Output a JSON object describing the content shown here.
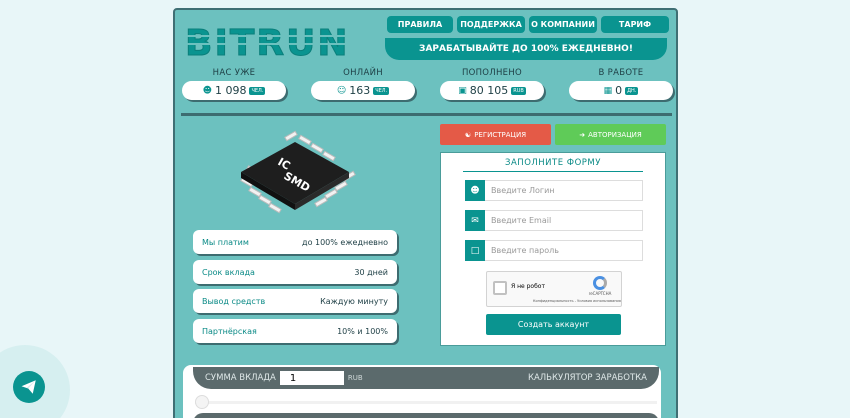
{
  "header": {
    "logo_text": "BITRUN",
    "nav": [
      "ПРАВИЛА",
      "ПОДДЕРЖКА",
      "О КОМПАНИИ",
      "ТАРИФ"
    ],
    "tagline": "ЗАРАБАТЫВАЙТЕ ДО 100% ЕЖЕДНЕВНО!"
  },
  "stats": [
    {
      "label": "НАС УЖЕ",
      "value": "1 098",
      "unit": "ЧЕЛ.",
      "icon": "users-icon"
    },
    {
      "label": "ОНЛАЙН",
      "value": "163",
      "unit": "ЧЕЛ.",
      "icon": "user-online-icon"
    },
    {
      "label": "ПОПОЛНЕНО",
      "value": "80 105",
      "unit": "RUB",
      "icon": "money-icon"
    },
    {
      "label": "В РАБОТЕ",
      "value": "0",
      "unit": "ДН.",
      "icon": "calendar-icon"
    }
  ],
  "chip_labels": [
    "IC",
    "SMD"
  ],
  "info": [
    {
      "label": "Мы платим",
      "value": "до 100% ежедневно"
    },
    {
      "label": "Срок вклада",
      "value": "30 дней"
    },
    {
      "label": "Вывод средств",
      "value": "Каждую минуту"
    },
    {
      "label": "Партнёрская",
      "value": "10% и 100%"
    }
  ],
  "auth": {
    "register_tab": "РЕГИСТРАЦИЯ",
    "login_tab": "АВТОРИЗАЦИЯ",
    "form_title": "ЗАПОЛНИТЕ ФОРМУ",
    "login_placeholder": "Введите Логин",
    "email_placeholder": "Введите Email",
    "password_placeholder": "Введите пароль",
    "captcha_label": "Я не робот",
    "captcha_brand": "reCAPTCHA",
    "captcha_terms": "Конфиденциальность - Условия использования",
    "submit": "Создать аккаунт"
  },
  "calculator": {
    "amount_label": "СУММА ВКЛАДА",
    "amount_value": "1",
    "currency": "RUB",
    "title": "КАЛЬКУЛЯТОР ЗАРАБОТКА"
  },
  "colors": {
    "accent": "#0a9490",
    "background": "#6cc1bf",
    "register": "#e45a47",
    "login": "#5fcb58"
  }
}
